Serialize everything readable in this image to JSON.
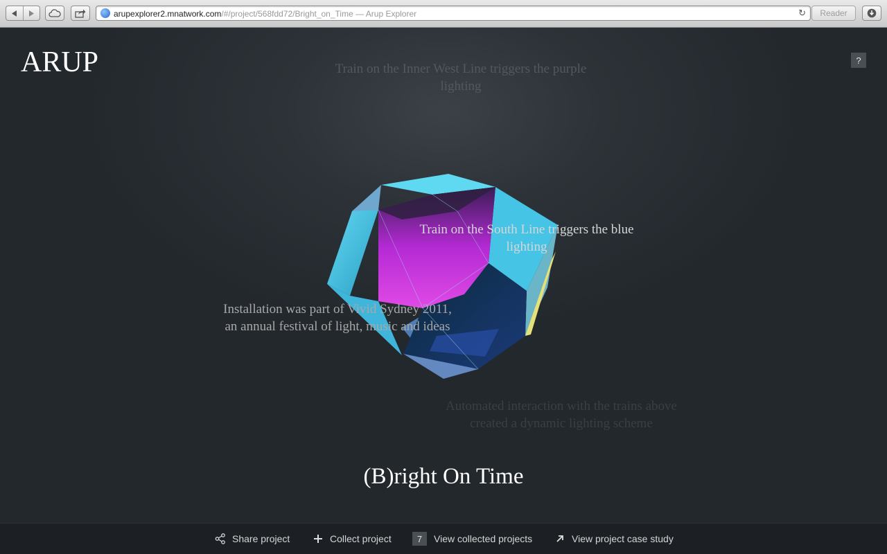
{
  "browser": {
    "url_host": "arupexplorer2.mnatwork.com",
    "url_path": "/#/project/568fdd72/Bright_on_Time",
    "page_title": "— Arup Explorer",
    "reader_label": "Reader"
  },
  "header": {
    "logo": "ARUP",
    "help_label": "?"
  },
  "captions": {
    "top": "Train on the Inner West Line triggers the purple lighting",
    "right": "Train on the South Line triggers the blue lighting",
    "left": "Installation was part of Vivid Sydney 2011, an annual festival of light, music and ideas",
    "bottom": "Automated interaction with the trains above created a dynamic lighting scheme"
  },
  "project": {
    "title": "(B)right On Time"
  },
  "footer": {
    "share_label": "Share project",
    "collect_label": "Collect project",
    "collected_count": "7",
    "view_collected_label": "View collected projects",
    "case_study_label": "View project case study"
  },
  "colors": {
    "background": "#23282d",
    "footer": "#1c2024",
    "accent_cyan": "#3ec6e8",
    "accent_magenta": "#d12ee8"
  }
}
